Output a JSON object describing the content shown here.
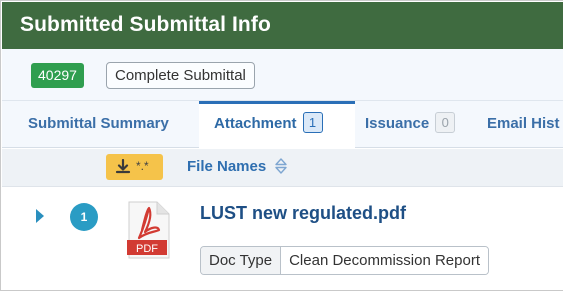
{
  "header": {
    "title": "Submitted Submittal Info"
  },
  "submittal": {
    "id": "40297",
    "status": "Complete Submittal"
  },
  "tabs": [
    {
      "label": "Submittal Summary"
    },
    {
      "label": "Attachment",
      "count": "1"
    },
    {
      "label": "Issuance",
      "count": "0"
    },
    {
      "label": "Email Hist"
    }
  ],
  "toolbar": {
    "download_ext": "*.*",
    "column_label": "File Names"
  },
  "files": [
    {
      "index": "1",
      "icon_label": "PDF",
      "name": "LUST new regulated.pdf",
      "doc_type_label": "Doc Type",
      "doc_type_value": "Clean Decommission Report"
    }
  ],
  "colors": {
    "header_bg": "#3f6b40",
    "badge_green": "#2f9e4f",
    "tab_accent": "#2a6fb7",
    "download_btn": "#f5c34a",
    "row_number": "#2a9cc4",
    "pdf_red": "#d23b33"
  }
}
